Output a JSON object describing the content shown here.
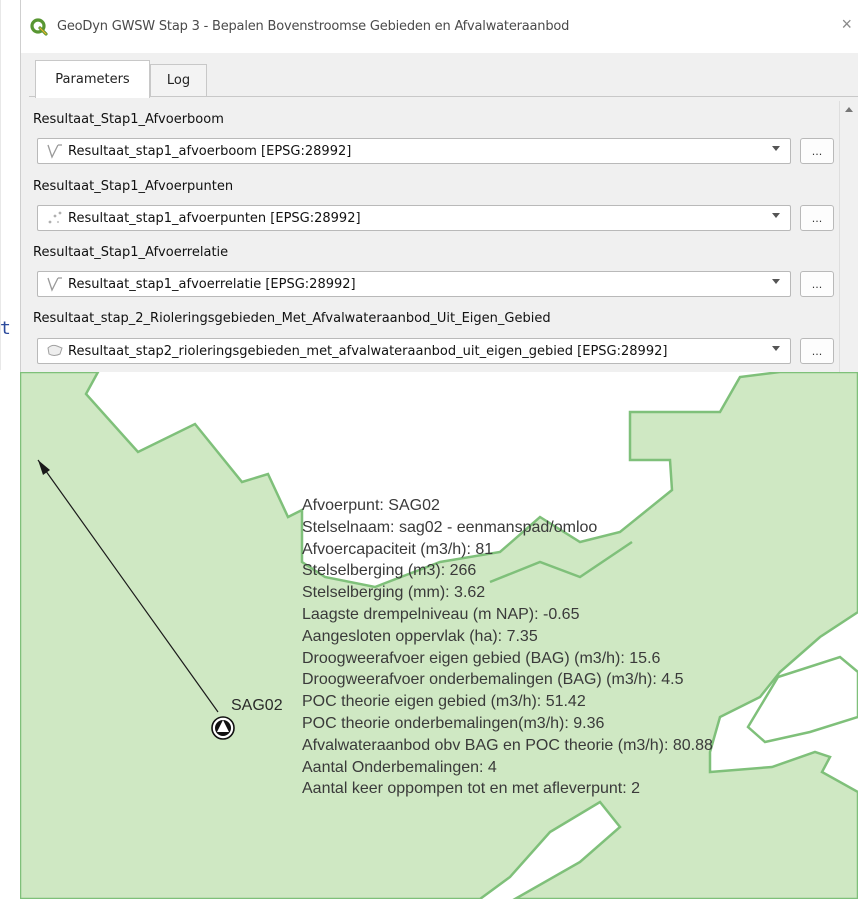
{
  "window": {
    "title": "GeoDyn GWSW Stap 3 - Bepalen Bovenstroomse Gebieden en Afvalwateraanbod",
    "close_glyph": "×"
  },
  "left_edge_glyph": "t",
  "tabs": [
    {
      "label": "Parameters",
      "active": true
    },
    {
      "label": "Log",
      "active": false
    }
  ],
  "parameters": [
    {
      "label": "Resultaat_Stap1_Afvoerboom",
      "value": "Resultaat_stap1_afvoerboom [EPSG:28992]",
      "icon": "line-layer-icon"
    },
    {
      "label": "Resultaat_Stap1_Afvoerpunten",
      "value": "Resultaat_stap1_afvoerpunten [EPSG:28992]",
      "icon": "point-layer-icon"
    },
    {
      "label": "Resultaat_Stap1_Afvoerrelatie",
      "value": "Resultaat_stap1_afvoerrelatie [EPSG:28992]",
      "icon": "line-layer-icon"
    },
    {
      "label": "Resultaat_stap_2_Rioleringsgebieden_Met_Afvalwateraanbod_Uit_Eigen_Gebied",
      "value": "Resultaat_stap2_rioleringsgebieden_met_afvalwateraanbod_uit_eigen_gebied [EPSG:28992]",
      "icon": "polygon-layer-icon"
    }
  ],
  "browse_button_label": "...",
  "map": {
    "point_label": "SAG02",
    "info_lines": [
      "Afvoerpunt: SAG02",
      "Stelselnaam: sag02 - eenmanspad/omloo",
      "Afvoercapaciteit (m3/h): 81",
      "Stelselberging (m3): 266",
      "Stelselberging (mm): 3.62",
      "Laagste drempelniveau (m NAP): -0.65",
      "Aangesloten oppervlak (ha): 7.35",
      "Droogweerafvoer eigen gebied (BAG) (m3/h): 15.6",
      "Droogweerafvoer onderbemalingen (BAG) (m3/h): 4.5",
      "POC theorie eigen gebied (m3/h): 51.42",
      "POC theorie onderbemalingen(m3/h): 9.36",
      "Afvalwateraanbod obv BAG en POC theorie (m3/h): 80.88",
      "Aantal Onderbemalingen: 4",
      "Aantal keer oppompen tot en met afleverpunt: 2"
    ],
    "colors": {
      "polygon_fill": "#cfe8c3",
      "polygon_stroke": "#7fc07a",
      "accent_qgis": "#589632"
    }
  }
}
